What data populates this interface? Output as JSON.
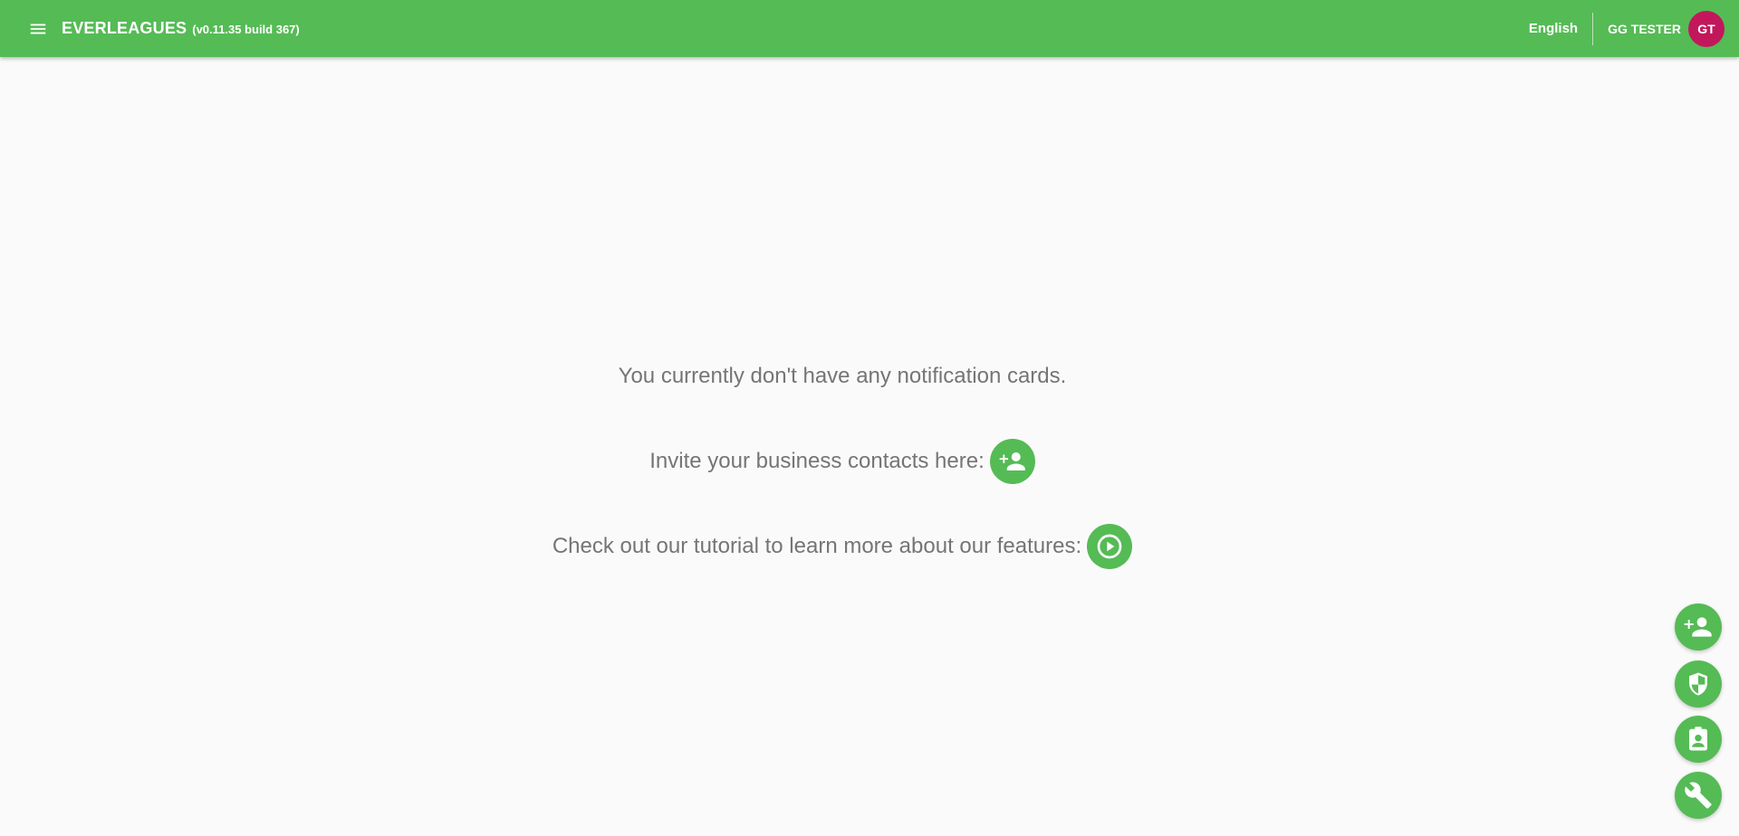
{
  "colors": {
    "accent": "#55bb55",
    "avatar": "#c2185b"
  },
  "header": {
    "menu_icon": "hamburger-menu-icon",
    "title": "EVERLEAGUES",
    "version": "(v0.11.35 build 367)",
    "language": "English",
    "user_name": "GG TESTER",
    "avatar_initials": "GT"
  },
  "main": {
    "empty_message": "You currently don't have any notification cards.",
    "invite_text": "Invite your business contacts here:",
    "invite_icon": "person-add-icon",
    "tutorial_text": "Check out our tutorial to learn more about our features:",
    "tutorial_icon": "play-circle-icon"
  },
  "fabs": [
    {
      "icon": "person-add-icon"
    },
    {
      "icon": "shield-icon"
    },
    {
      "icon": "contact-badge-icon"
    },
    {
      "icon": "wrench-icon"
    }
  ]
}
